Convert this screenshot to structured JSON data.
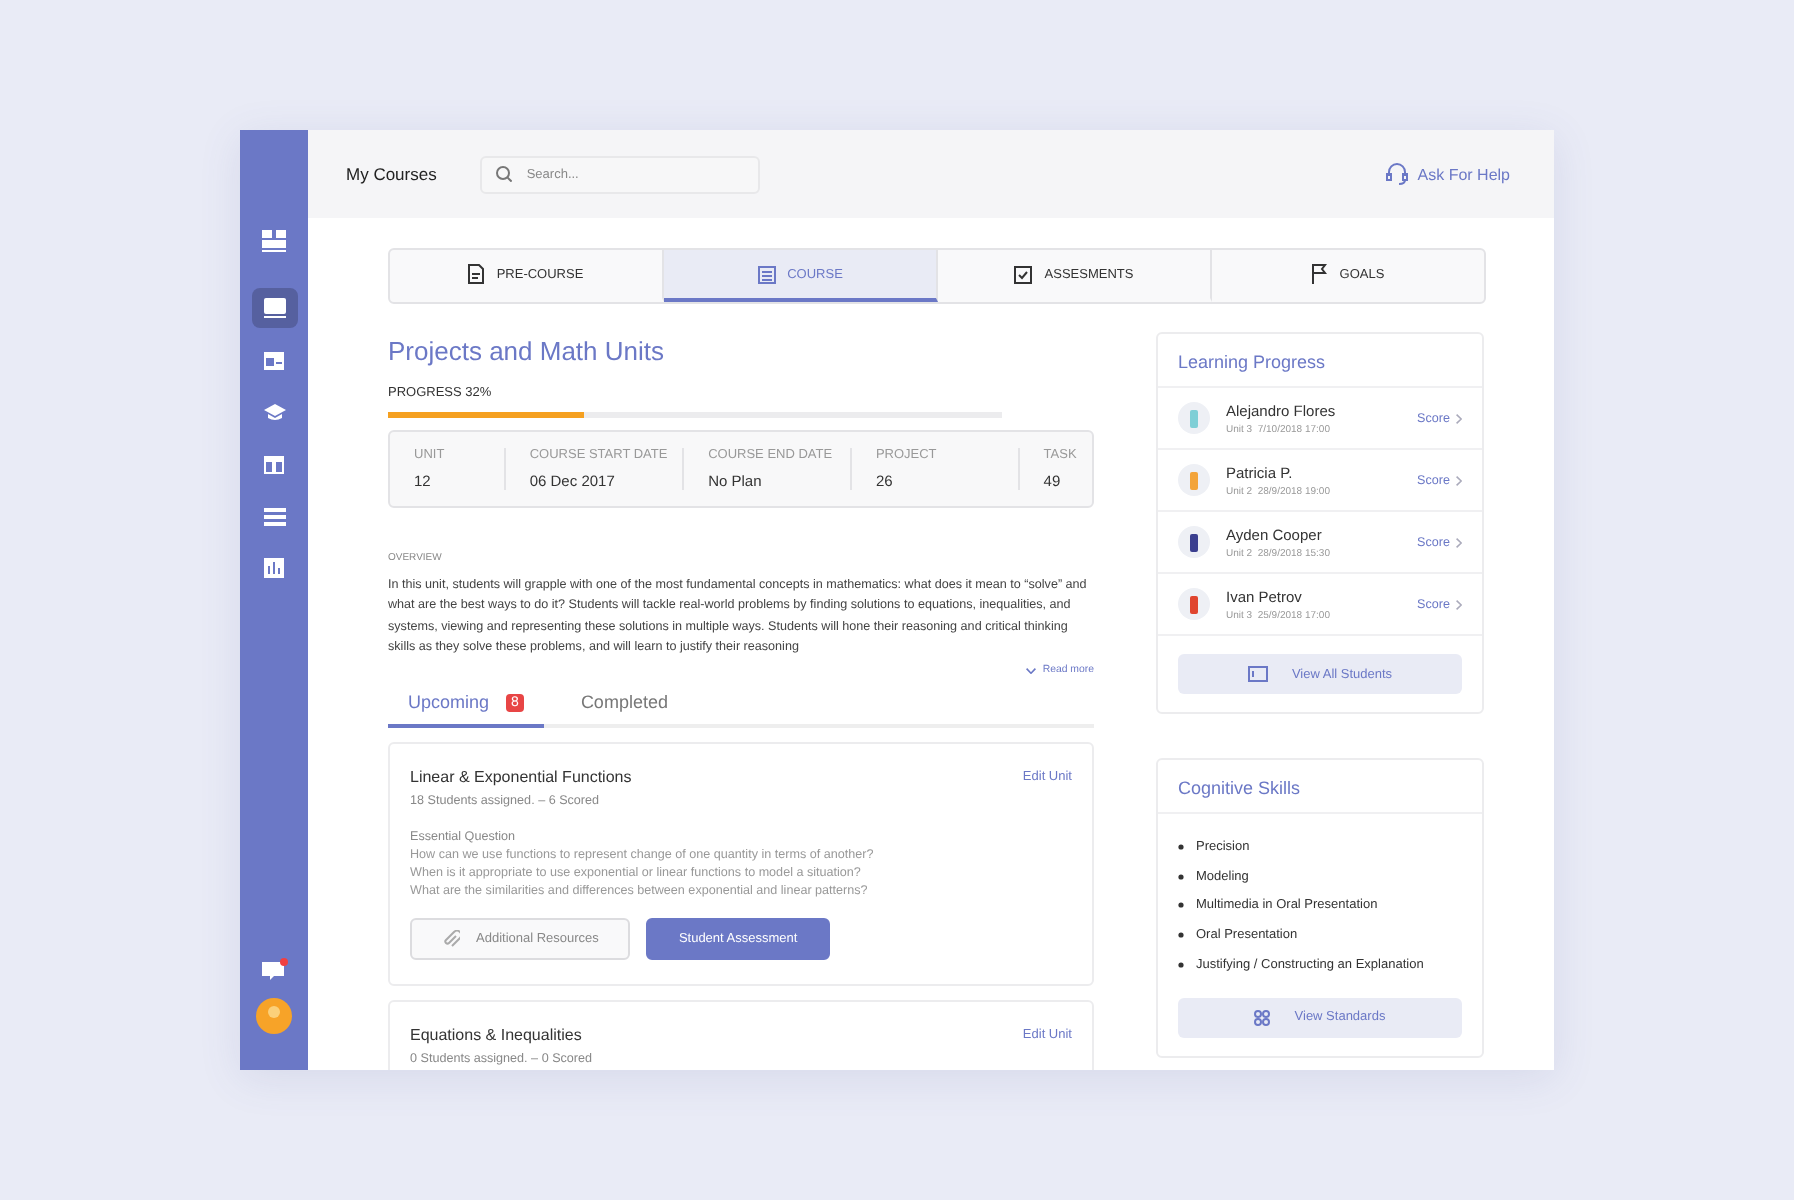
{
  "header": {
    "title": "My Courses",
    "search": {
      "placeholder": "Search..."
    },
    "help": "Ask For Help"
  },
  "sidebar": {
    "items": [
      {
        "selected": false
      },
      {
        "selected": true
      },
      {
        "selected": false
      },
      {
        "selected": false
      },
      {
        "selected": false
      },
      {
        "selected": false
      },
      {
        "selected": false
      }
    ],
    "chat_unread": true
  },
  "tabs": [
    {
      "label": "PRE-COURSE",
      "selected": false
    },
    {
      "label": "COURSE",
      "selected": true
    },
    {
      "label": "ASSESMENTS",
      "selected": false
    },
    {
      "label": "GOALS",
      "selected": false
    }
  ],
  "course": {
    "title": "Projects and Math Units",
    "progress_label": "PROGRESS 32%",
    "level": 0.32,
    "stats": [
      {
        "label": "UNIT",
        "value": "12"
      },
      {
        "label": "COURSE START DATE",
        "value": "06 Dec 2017"
      },
      {
        "label": "COURSE END DATE",
        "value": "No Plan"
      },
      {
        "label": "PROJECT",
        "value": "26"
      },
      {
        "label": "TASK",
        "value": "49"
      }
    ],
    "overview_label": "OVERVIEW",
    "overview": "In this unit, students will grapple with one of the most fundamental concepts in mathematics: what does it mean to “solve” and what are the best ways to do it? Students will tackle real-world problems by finding solutions to equations, inequalities, and systems, viewing and representing these solutions in multiple ways. Students will hone their reasoning and critical thinking skills as they solve these problems, and will learn to justify their reasoning",
    "read_more": "Read more"
  },
  "unit_tabs": [
    {
      "label": "Upcoming",
      "badge": "8",
      "selected": true
    },
    {
      "label": "Completed",
      "selected": false
    }
  ],
  "units": [
    {
      "title": "Linear & Exponential Functions",
      "meta": "18 Students assigned. – 6 Scored",
      "edit": "Edit Unit",
      "question_label": "Essential Question",
      "questions": [
        "How can we use functions to represent change of one quantity in terms of another?",
        "When is it appropriate to use exponential or linear functions to model a situation?",
        "What are the similarities and differences between exponential and linear patterns?"
      ],
      "buttons": [
        {
          "label": "Additional Resources",
          "kind": "secondary"
        },
        {
          "label": "Student Assessment",
          "kind": "primary"
        }
      ]
    },
    {
      "title": "Equations & Inequalities",
      "meta": "0 Students assigned. – 0 Scored",
      "edit": "Edit Unit"
    }
  ],
  "learning_progress": {
    "title": "Learning Progress",
    "students": [
      {
        "name": "Alejandro Flores",
        "unit": "Unit 3",
        "date": "7/10/2018 17:00",
        "action": "Score",
        "color": "#7fcfd6"
      },
      {
        "name": "Patricia P.",
        "unit": "Unit 2",
        "date": "28/9/2018 19:00",
        "action": "Score",
        "color": "#f3a43a"
      },
      {
        "name": "Ayden Cooper",
        "unit": "Unit 2",
        "date": "28/9/2018 15:30",
        "action": "Score",
        "color": "#3b3f8f"
      },
      {
        "name": "Ivan Petrov",
        "unit": "Unit 3",
        "date": "25/9/2018 17:00",
        "action": "Score",
        "color": "#e0452f"
      }
    ],
    "button": "View All Students"
  },
  "cognitive_skills": {
    "title": "Cognitive Skills",
    "items": [
      "Precision",
      "Modeling",
      "Multimedia in Oral Presentation",
      "Oral Presentation",
      "Justifying / Constructing an Explanation"
    ],
    "button": "View Standards"
  }
}
